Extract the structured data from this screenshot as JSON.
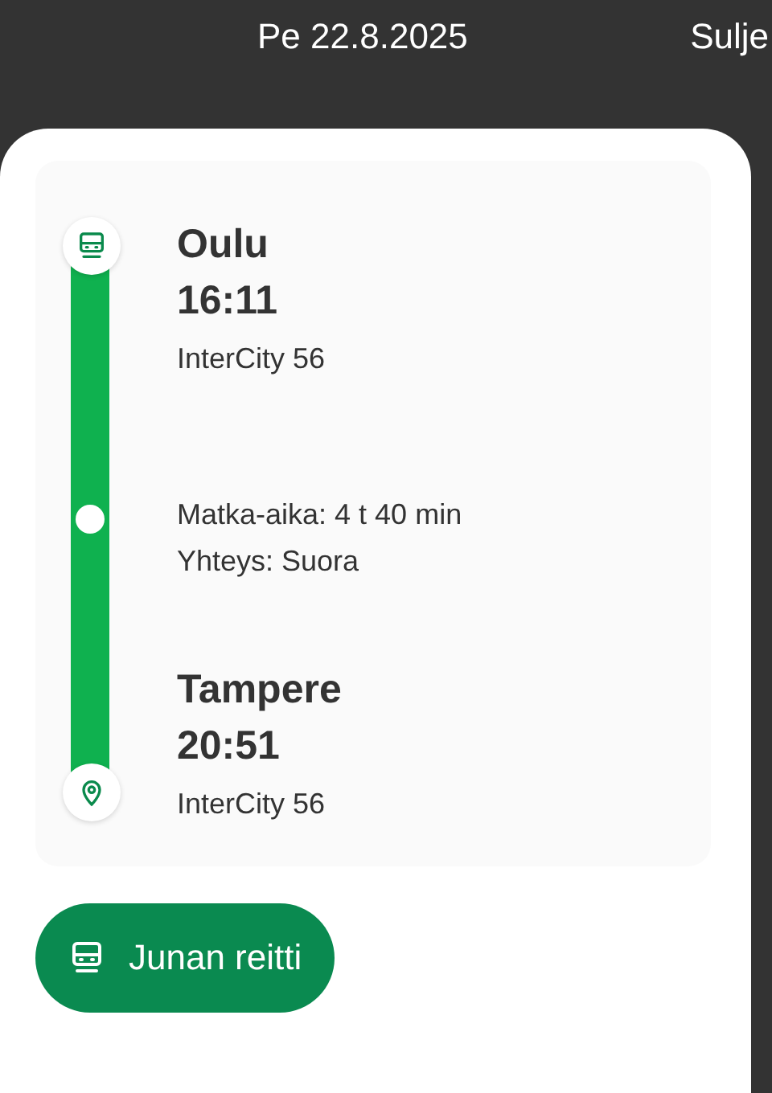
{
  "header": {
    "date": "Pe 22.8.2025",
    "close": "Sulje"
  },
  "stops": [
    {
      "kind": "origin",
      "station": "Oulu",
      "time": "16:11",
      "train": "InterCity 56"
    },
    {
      "kind": "destination",
      "station": "Tampere",
      "time": "20:51",
      "train": "InterCity 56"
    }
  ],
  "journey": {
    "duration": "Matka-aika: 4 t 40 min",
    "connection": "Yhteys: Suora"
  },
  "route_button": {
    "label": "Junan reitti"
  }
}
